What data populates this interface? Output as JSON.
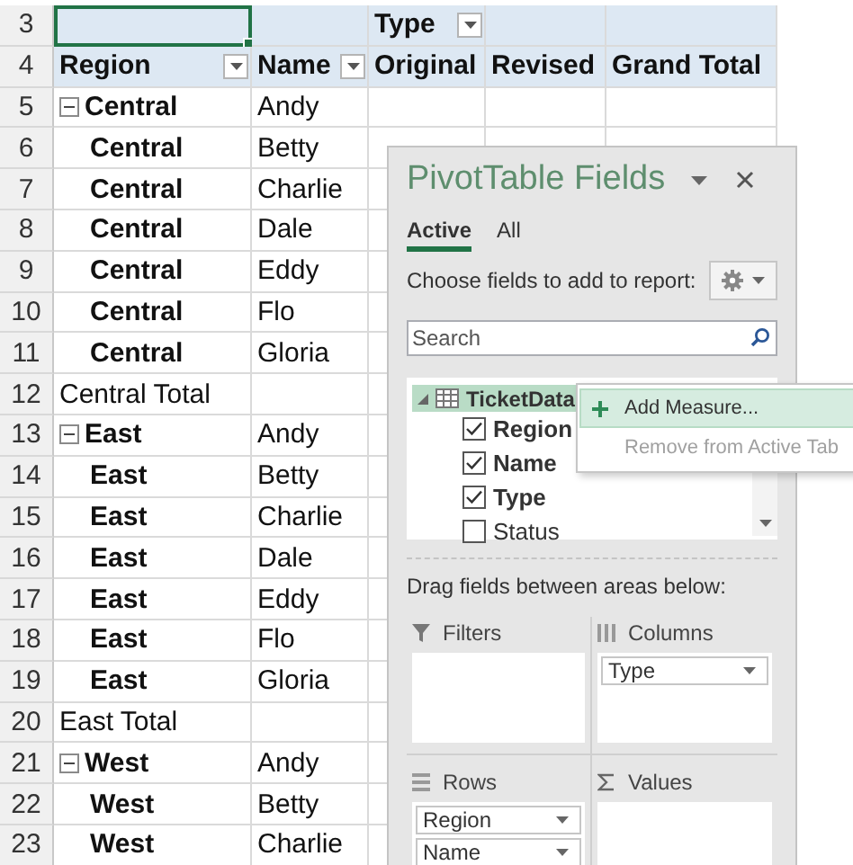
{
  "sheet": {
    "rows": [
      {
        "number": "3",
        "kind": "column_label",
        "active_cell": true,
        "label": "Type",
        "filter": true
      },
      {
        "number": "4",
        "kind": "headers",
        "headers": [
          {
            "text": "Region",
            "filter": true
          },
          {
            "text": "Name",
            "filter": true
          },
          {
            "text": "Original",
            "filter": false
          },
          {
            "text": "Revised",
            "filter": false
          },
          {
            "text": "Grand Total",
            "filter": false
          }
        ]
      },
      {
        "number": "5",
        "kind": "group",
        "expanded": true,
        "region": "Central",
        "name": "Andy"
      },
      {
        "number": "6",
        "kind": "item",
        "region": "Central",
        "name": "Betty"
      },
      {
        "number": "7",
        "kind": "item",
        "region": "Central",
        "name": "Charlie"
      },
      {
        "number": "8",
        "kind": "item",
        "region": "Central",
        "name": "Dale"
      },
      {
        "number": "9",
        "kind": "item",
        "region": "Central",
        "name": "Eddy"
      },
      {
        "number": "10",
        "kind": "item",
        "region": "Central",
        "name": "Flo"
      },
      {
        "number": "11",
        "kind": "item",
        "region": "Central",
        "name": "Gloria"
      },
      {
        "number": "12",
        "kind": "total",
        "label": "Central Total"
      },
      {
        "number": "13",
        "kind": "group",
        "expanded": true,
        "region": "East",
        "name": "Andy"
      },
      {
        "number": "14",
        "kind": "item",
        "region": "East",
        "name": "Betty"
      },
      {
        "number": "15",
        "kind": "item",
        "region": "East",
        "name": "Charlie"
      },
      {
        "number": "16",
        "kind": "item",
        "region": "East",
        "name": "Dale"
      },
      {
        "number": "17",
        "kind": "item",
        "region": "East",
        "name": "Eddy"
      },
      {
        "number": "18",
        "kind": "item",
        "region": "East",
        "name": "Flo"
      },
      {
        "number": "19",
        "kind": "item",
        "region": "East",
        "name": "Gloria"
      },
      {
        "number": "20",
        "kind": "total",
        "label": "East Total"
      },
      {
        "number": "21",
        "kind": "group",
        "expanded": true,
        "region": "West",
        "name": "Andy"
      },
      {
        "number": "22",
        "kind": "item",
        "region": "West",
        "name": "Betty"
      },
      {
        "number": "23",
        "kind": "item",
        "region": "West",
        "name": "Charlie"
      }
    ]
  },
  "pane": {
    "title": "PivotTable Fields",
    "tabs": [
      {
        "label": "Active",
        "selected": true
      },
      {
        "label": "All",
        "selected": false
      }
    ],
    "instruction": "Choose fields to add to report:",
    "search": {
      "placeholder": "Search"
    },
    "table": {
      "name": "TicketData",
      "expanded": true,
      "selected": true,
      "fields": [
        {
          "name": "Region",
          "checked": true
        },
        {
          "name": "Name",
          "checked": true
        },
        {
          "name": "Type",
          "checked": true
        },
        {
          "name": "Status",
          "checked": false
        }
      ]
    },
    "areas_hint": "Drag fields between areas below:",
    "areas": [
      {
        "kind": "filters",
        "label": "Filters"
      },
      {
        "kind": "columns",
        "label": "Columns",
        "items": [
          "Type"
        ]
      },
      {
        "kind": "rows",
        "label": "Rows",
        "items": [
          "Region",
          "Name"
        ]
      },
      {
        "kind": "values",
        "label": "Values"
      }
    ]
  },
  "context_menu": [
    {
      "kind": "add",
      "label": "Add Measure...",
      "selected": true,
      "disabled": false
    },
    {
      "kind": "remove",
      "label": "Remove from Active Tab",
      "selected": false,
      "disabled": true
    }
  ]
}
